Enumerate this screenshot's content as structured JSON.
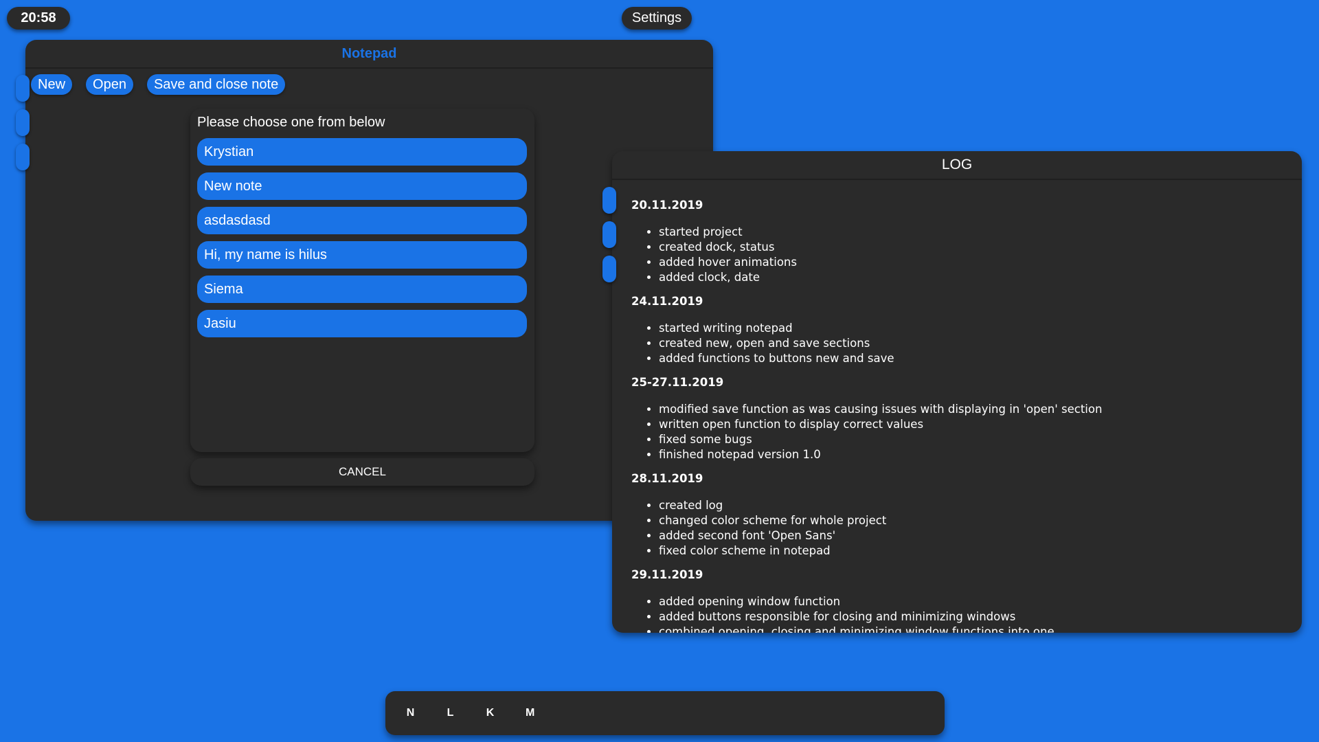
{
  "status": {
    "clock": "20:58",
    "settings_label": "Settings"
  },
  "notepad": {
    "title": "Notepad",
    "toolbar": {
      "new_label": "New",
      "open_label": "Open",
      "save_close_label": "Save and close note"
    }
  },
  "chooser": {
    "prompt": "Please choose one from below",
    "notes": [
      "Krystian",
      "New note",
      "asdasdasd",
      "Hi, my name is hilus",
      "Siema",
      "Jasiu"
    ],
    "cancel_label": "CANCEL"
  },
  "log": {
    "title": "LOG",
    "entries": [
      {
        "date": "20.11.2019",
        "items": [
          "started project",
          "created dock, status",
          "added hover animations",
          "added clock, date"
        ]
      },
      {
        "date": "24.11.2019",
        "items": [
          "started writing notepad",
          "created new, open and save sections",
          "added functions to buttons new and save"
        ]
      },
      {
        "date": "25-27.11.2019",
        "items": [
          "modified save function as was causing issues with displaying in 'open' section",
          "written open function to display correct values",
          "fixed some bugs",
          "finished notepad version 1.0"
        ]
      },
      {
        "date": "28.11.2019",
        "items": [
          "created log",
          "changed color scheme for whole project",
          "added second font 'Open Sans'",
          "fixed color scheme in notepad"
        ]
      },
      {
        "date": "29.11.2019",
        "items": [
          "added opening window function",
          "added buttons responsible for closing and minimizing windows",
          "combined opening, closing and minimizing window functions into one"
        ]
      }
    ]
  },
  "dock": {
    "items": [
      "N",
      "L",
      "K",
      "M"
    ]
  },
  "colors": {
    "accent": "#1a73e6",
    "window": "#2a2a2a"
  }
}
